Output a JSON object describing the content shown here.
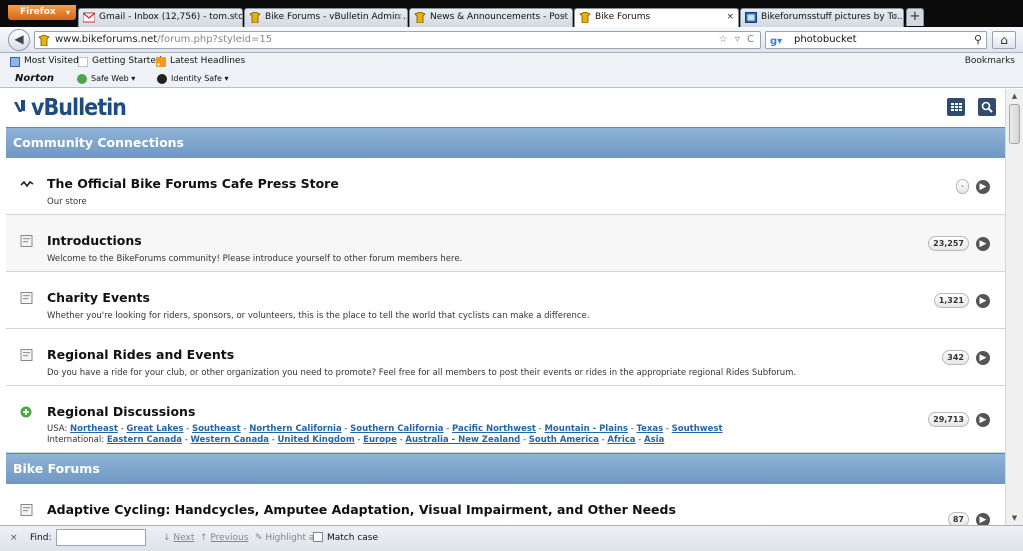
{
  "browser": {
    "firefox_button": "Firefox",
    "tabs": [
      {
        "label": "Gmail - Inbox (12,756) - tom.sto..."
      },
      {
        "label": "Bike Forums - vBulletin Admin ..."
      },
      {
        "label": "News & Announcements - Post ..."
      },
      {
        "label": "Bike Forums"
      },
      {
        "label": "Bikeforumsstuff pictures by To..."
      }
    ],
    "new_tab": "+",
    "url_domain": "www.bikeforums.net",
    "url_path": "/forum.php?styleid=15",
    "url_icons": "☆ ▿ C",
    "search_text": "photobucket",
    "search_engine_icon": "google-icon",
    "bookmarks": [
      {
        "label": "Most Visited"
      },
      {
        "label": "Getting Started"
      },
      {
        "label": "Latest Headlines"
      }
    ],
    "bookmarks_right": "Bookmarks",
    "norton": {
      "logo": "Norton",
      "items": [
        {
          "label": "Safe Web"
        },
        {
          "label": "Identity Safe"
        }
      ]
    }
  },
  "site": {
    "logo": "vBulletin",
    "sections": [
      {
        "title": "Community Connections"
      },
      {
        "title": "Bike Forums"
      }
    ],
    "forums": [
      {
        "title": "The Official Bike Forums Cafe Press Store",
        "desc": "Our store",
        "count": "·",
        "icon": "link-icon"
      },
      {
        "title": "Introductions",
        "desc": "Welcome to the BikeForums community! Please introduce yourself to other forum members here.",
        "count": "23,257",
        "icon": "forum-icon"
      },
      {
        "title": "Charity Events",
        "desc": "Whether you're looking for riders, sponsors, or volunteers, this is the place to tell the world that cyclists can make a difference.",
        "count": "1,321",
        "icon": "forum-icon"
      },
      {
        "title": "Regional Rides and Events",
        "desc": "Do you have a ride for your club, or other organization you need to promote? Feel free for all members to post their events or rides in the appropriate regional Rides Subforum.",
        "count": "342",
        "icon": "forum-icon"
      },
      {
        "title": "Regional Discussions",
        "usa_label": "USA:",
        "usa_links": [
          "Northeast",
          "Great Lakes",
          "Southeast",
          "Northern California",
          "Southern California",
          "Pacific Northwest",
          "Mountain - Plains",
          "Texas",
          "Southwest"
        ],
        "intl_label": "International:",
        "intl_links": [
          "Eastern Canada",
          "Western Canada",
          "United Kingdom",
          "Europe",
          "Australia - New Zealand",
          "South America",
          "Africa",
          "Asia"
        ],
        "count": "29,713",
        "icon": "plus-icon"
      },
      {
        "title": "Adaptive Cycling: Handcycles, Amputee Adaptation, Visual Impairment, and Other Needs",
        "count": "87",
        "icon": "forum-icon"
      }
    ]
  },
  "findbar": {
    "close": "×",
    "label": "Find:",
    "value": "",
    "next": "Next",
    "previous": "Previous",
    "highlight": "Highlight all",
    "match_case": "Match case"
  }
}
